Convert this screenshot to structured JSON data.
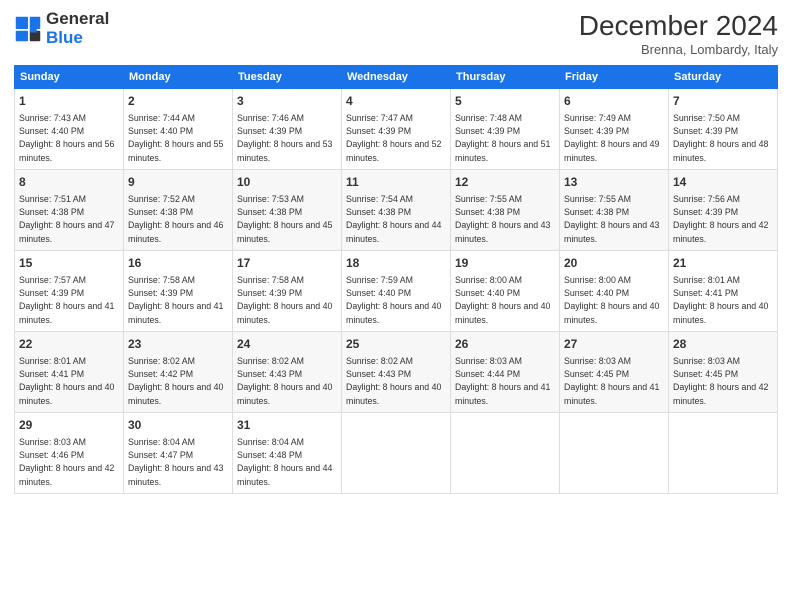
{
  "header": {
    "logo_line1": "General",
    "logo_line2": "Blue",
    "month_title": "December 2024",
    "location": "Brenna, Lombardy, Italy"
  },
  "weekdays": [
    "Sunday",
    "Monday",
    "Tuesday",
    "Wednesday",
    "Thursday",
    "Friday",
    "Saturday"
  ],
  "weeks": [
    [
      {
        "day": "1",
        "sunrise": "7:43 AM",
        "sunset": "4:40 PM",
        "daylight": "8 hours and 56 minutes."
      },
      {
        "day": "2",
        "sunrise": "7:44 AM",
        "sunset": "4:40 PM",
        "daylight": "8 hours and 55 minutes."
      },
      {
        "day": "3",
        "sunrise": "7:46 AM",
        "sunset": "4:39 PM",
        "daylight": "8 hours and 53 minutes."
      },
      {
        "day": "4",
        "sunrise": "7:47 AM",
        "sunset": "4:39 PM",
        "daylight": "8 hours and 52 minutes."
      },
      {
        "day": "5",
        "sunrise": "7:48 AM",
        "sunset": "4:39 PM",
        "daylight": "8 hours and 51 minutes."
      },
      {
        "day": "6",
        "sunrise": "7:49 AM",
        "sunset": "4:39 PM",
        "daylight": "8 hours and 49 minutes."
      },
      {
        "day": "7",
        "sunrise": "7:50 AM",
        "sunset": "4:39 PM",
        "daylight": "8 hours and 48 minutes."
      }
    ],
    [
      {
        "day": "8",
        "sunrise": "7:51 AM",
        "sunset": "4:38 PM",
        "daylight": "8 hours and 47 minutes."
      },
      {
        "day": "9",
        "sunrise": "7:52 AM",
        "sunset": "4:38 PM",
        "daylight": "8 hours and 46 minutes."
      },
      {
        "day": "10",
        "sunrise": "7:53 AM",
        "sunset": "4:38 PM",
        "daylight": "8 hours and 45 minutes."
      },
      {
        "day": "11",
        "sunrise": "7:54 AM",
        "sunset": "4:38 PM",
        "daylight": "8 hours and 44 minutes."
      },
      {
        "day": "12",
        "sunrise": "7:55 AM",
        "sunset": "4:38 PM",
        "daylight": "8 hours and 43 minutes."
      },
      {
        "day": "13",
        "sunrise": "7:55 AM",
        "sunset": "4:38 PM",
        "daylight": "8 hours and 43 minutes."
      },
      {
        "day": "14",
        "sunrise": "7:56 AM",
        "sunset": "4:39 PM",
        "daylight": "8 hours and 42 minutes."
      }
    ],
    [
      {
        "day": "15",
        "sunrise": "7:57 AM",
        "sunset": "4:39 PM",
        "daylight": "8 hours and 41 minutes."
      },
      {
        "day": "16",
        "sunrise": "7:58 AM",
        "sunset": "4:39 PM",
        "daylight": "8 hours and 41 minutes."
      },
      {
        "day": "17",
        "sunrise": "7:58 AM",
        "sunset": "4:39 PM",
        "daylight": "8 hours and 40 minutes."
      },
      {
        "day": "18",
        "sunrise": "7:59 AM",
        "sunset": "4:40 PM",
        "daylight": "8 hours and 40 minutes."
      },
      {
        "day": "19",
        "sunrise": "8:00 AM",
        "sunset": "4:40 PM",
        "daylight": "8 hours and 40 minutes."
      },
      {
        "day": "20",
        "sunrise": "8:00 AM",
        "sunset": "4:40 PM",
        "daylight": "8 hours and 40 minutes."
      },
      {
        "day": "21",
        "sunrise": "8:01 AM",
        "sunset": "4:41 PM",
        "daylight": "8 hours and 40 minutes."
      }
    ],
    [
      {
        "day": "22",
        "sunrise": "8:01 AM",
        "sunset": "4:41 PM",
        "daylight": "8 hours and 40 minutes."
      },
      {
        "day": "23",
        "sunrise": "8:02 AM",
        "sunset": "4:42 PM",
        "daylight": "8 hours and 40 minutes."
      },
      {
        "day": "24",
        "sunrise": "8:02 AM",
        "sunset": "4:43 PM",
        "daylight": "8 hours and 40 minutes."
      },
      {
        "day": "25",
        "sunrise": "8:02 AM",
        "sunset": "4:43 PM",
        "daylight": "8 hours and 40 minutes."
      },
      {
        "day": "26",
        "sunrise": "8:03 AM",
        "sunset": "4:44 PM",
        "daylight": "8 hours and 41 minutes."
      },
      {
        "day": "27",
        "sunrise": "8:03 AM",
        "sunset": "4:45 PM",
        "daylight": "8 hours and 41 minutes."
      },
      {
        "day": "28",
        "sunrise": "8:03 AM",
        "sunset": "4:45 PM",
        "daylight": "8 hours and 42 minutes."
      }
    ],
    [
      {
        "day": "29",
        "sunrise": "8:03 AM",
        "sunset": "4:46 PM",
        "daylight": "8 hours and 42 minutes."
      },
      {
        "day": "30",
        "sunrise": "8:04 AM",
        "sunset": "4:47 PM",
        "daylight": "8 hours and 43 minutes."
      },
      {
        "day": "31",
        "sunrise": "8:04 AM",
        "sunset": "4:48 PM",
        "daylight": "8 hours and 44 minutes."
      },
      null,
      null,
      null,
      null
    ]
  ]
}
